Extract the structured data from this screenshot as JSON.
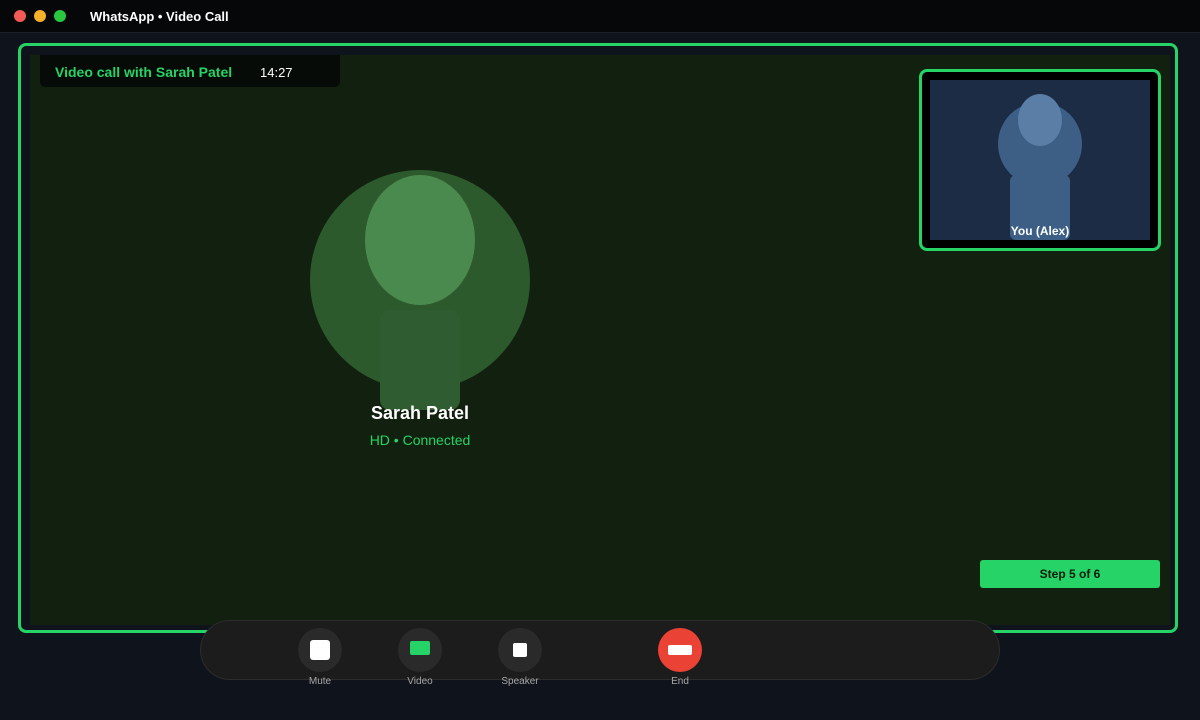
{
  "window": {
    "title": "WhatsApp • Video Call"
  },
  "call": {
    "title": "Video call with Sarah Patel",
    "timer": "14:27"
  },
  "remote": {
    "name": "Sarah Patel",
    "status": "HD • Connected"
  },
  "self_view": {
    "label": "You (Alex)"
  },
  "progress": {
    "step_label": "Step 5 of 6",
    "current": 5,
    "total": 6
  },
  "controls": [
    {
      "label": "Mute",
      "icon": "microphone-icon"
    },
    {
      "label": "Video",
      "icon": "video-camera-icon"
    },
    {
      "label": "Speaker",
      "icon": "speaker-icon"
    },
    {
      "label": "End",
      "icon": "end-call-icon"
    }
  ],
  "colors": {
    "accent": "#25d366",
    "end_call": "#ea4335",
    "call_background": "#12200f"
  }
}
